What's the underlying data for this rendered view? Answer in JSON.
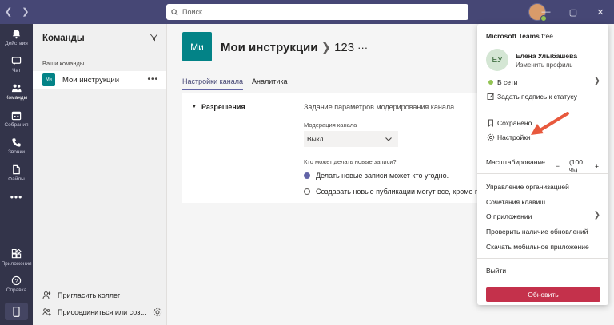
{
  "search": {
    "placeholder": "Поиск"
  },
  "appbar": {
    "items": [
      {
        "label": "Действия",
        "icon": "bell-icon"
      },
      {
        "label": "Чат",
        "icon": "chat-icon"
      },
      {
        "label": "Команды",
        "icon": "teams-icon"
      },
      {
        "label": "Собрания",
        "icon": "calendar-icon"
      },
      {
        "label": "Звонки",
        "icon": "phone-icon"
      },
      {
        "label": "Файлы",
        "icon": "files-icon"
      },
      {
        "label": "Приложения",
        "icon": "apps-icon"
      },
      {
        "label": "Справка",
        "icon": "help-icon"
      }
    ]
  },
  "leftpane": {
    "title": "Команды",
    "section": "Ваши команды",
    "team": {
      "initials": "Ми",
      "name": "Мои инструкции"
    },
    "invite": "Пригласить коллег",
    "join": "Присоединиться или соз..."
  },
  "main": {
    "tile": "Ми",
    "title": "Мои инструкции",
    "channel": "123",
    "tabs": [
      "Настройки канала",
      "Аналитика"
    ],
    "permissions": {
      "heading": "Разрешения",
      "description": "Задание параметров модерирования канала",
      "moderation_label": "Модерация канала",
      "moderation_value": "Выкл",
      "who_label": "Кто может делать новые записи?",
      "option1": "Делать новые записи может кто угодно.",
      "option2": "Создавать новые публикации могут все, кроме гост"
    }
  },
  "menu": {
    "app_name": "Microsoft Teams",
    "plan": "free",
    "avatar_initials": "ЕУ",
    "user_name": "Елена Улыбашева",
    "edit_profile": "Изменить профиль",
    "status": "В сети",
    "set_status_message": "Задать подпись к статусу",
    "saved": "Сохранено",
    "settings": "Настройки",
    "zoom_label": "Масштабирование",
    "zoom_value": "(100 %)",
    "manage_org": "Управление организацией",
    "shortcuts": "Сочетания клавиш",
    "about": "О приложении",
    "check_updates": "Проверить наличие обновлений",
    "download_mobile": "Скачать мобильное приложение",
    "sign_out": "Выйти",
    "update_button": "Обновить"
  },
  "colors": {
    "titlebar": "#464775",
    "appbar": "#33344a",
    "accent": "#6264a7",
    "team_tile": "#038387",
    "update_button": "#c4314b",
    "annotation_arrow": "#e8593d"
  }
}
